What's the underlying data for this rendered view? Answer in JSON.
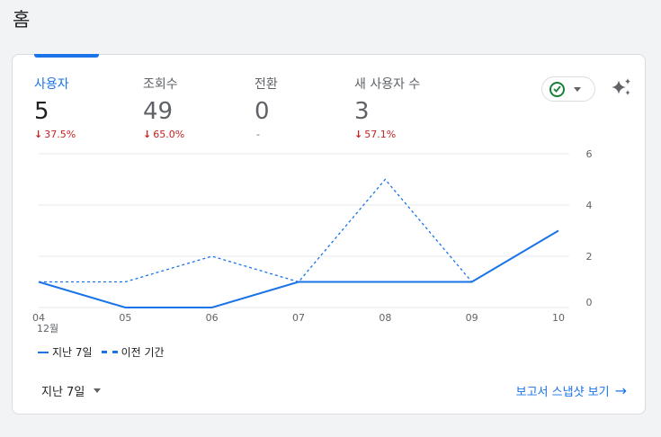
{
  "page": {
    "title": "홈"
  },
  "metrics": [
    {
      "label": "사용자",
      "value": "5",
      "change": "37.5%",
      "change_arrow": "↓"
    },
    {
      "label": "조회수",
      "value": "49",
      "change": "65.0%",
      "change_arrow": "↓"
    },
    {
      "label": "전환",
      "value": "0",
      "change": "-",
      "change_arrow": ""
    },
    {
      "label": "새 사용자 수",
      "value": "3",
      "change": "57.1%",
      "change_arrow": "↓"
    }
  ],
  "status_dropdown": {
    "icon": "check-circle-icon"
  },
  "insights": {
    "icon": "sparkle-icon"
  },
  "chart_data": {
    "type": "line",
    "x": [
      "04",
      "05",
      "06",
      "07",
      "08",
      "09",
      "10"
    ],
    "x_sublabel": "12월",
    "series": [
      {
        "name": "지난 7일",
        "style": "solid",
        "values": [
          1,
          0,
          0,
          1,
          1,
          1,
          3
        ]
      },
      {
        "name": "이전 기간",
        "style": "dashed",
        "values": [
          1,
          1,
          2,
          1,
          5,
          1,
          null
        ]
      }
    ],
    "y_ticks": [
      0,
      2,
      4,
      6
    ],
    "ylim": [
      0,
      6
    ],
    "color": "#1a73e8",
    "grid": true
  },
  "legend": {
    "current": "지난 7일",
    "previous": "이전 기간"
  },
  "footer": {
    "period_label": "지난 7일",
    "report_link": "보고서 스냅샷 보기",
    "arrow": "→"
  }
}
